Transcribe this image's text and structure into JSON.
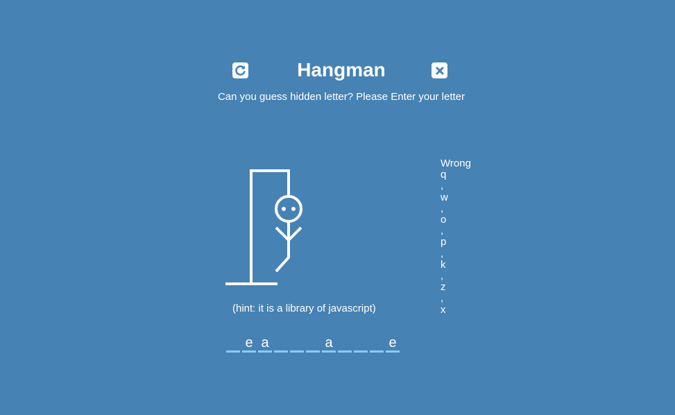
{
  "header": {
    "title": "Hangman",
    "subtitle": "Can you guess hidden letter? Please Enter your letter",
    "restart_icon": "restart-icon",
    "close_icon": "close-icon"
  },
  "game": {
    "hint": "(hint: it is a library of javascript)",
    "wrong_label": "Wrong",
    "wrong_letters": [
      "q",
      ",",
      "w",
      ",",
      "o",
      ",",
      "p",
      ",",
      "k",
      ",",
      "z",
      ",",
      "x"
    ],
    "word_slots": [
      "",
      "e",
      "a",
      "",
      "",
      "",
      "a",
      "",
      "",
      "",
      "e"
    ],
    "colors": {
      "background": "#4682b4",
      "foreground": "#ffffff",
      "slot_underline": "#87cefa"
    }
  }
}
